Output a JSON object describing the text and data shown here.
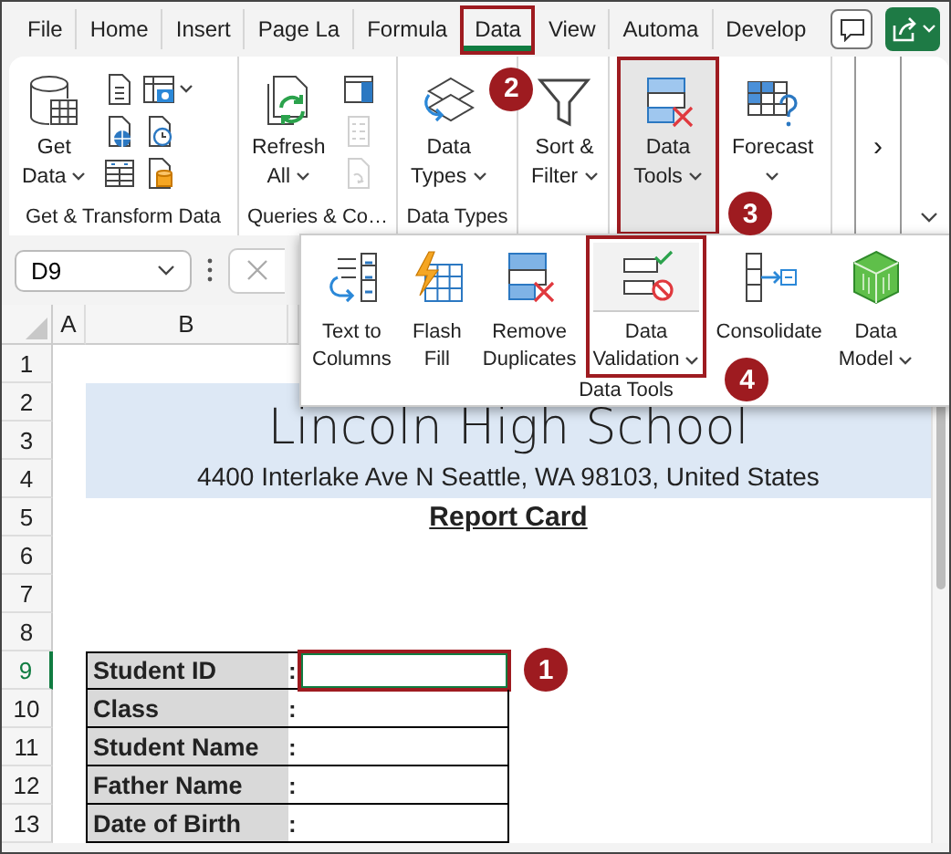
{
  "tabs": [
    {
      "label": "File",
      "selected": false
    },
    {
      "label": "Home",
      "selected": false
    },
    {
      "label": "Insert",
      "selected": false
    },
    {
      "label": "Page La",
      "selected": false
    },
    {
      "label": "Formula",
      "selected": false
    },
    {
      "label": "Data",
      "selected": true,
      "callout": "2"
    },
    {
      "label": "View",
      "selected": false
    },
    {
      "label": "Automa",
      "selected": false
    },
    {
      "label": "Develop",
      "selected": false
    }
  ],
  "ribbon": {
    "groups": [
      {
        "label": "Get & Transform Data",
        "buttons": [
          {
            "kind": "get-data",
            "lines": [
              "Get",
              "Data"
            ],
            "dropdown": true,
            "pressed": false
          }
        ],
        "small_buttons": [
          {
            "kind": "text-file",
            "dropdown": false,
            "disabled": false
          },
          {
            "kind": "picture-table",
            "dropdown": true,
            "disabled": false
          },
          {
            "kind": "web-file",
            "dropdown": false,
            "disabled": false
          },
          {
            "kind": "recent-file",
            "dropdown": false,
            "disabled": false
          },
          {
            "kind": "table",
            "dropdown": false,
            "disabled": false
          },
          {
            "kind": "database-file",
            "dropdown": false,
            "disabled": false
          }
        ]
      },
      {
        "label": "Queries & Co…",
        "buttons": [
          {
            "kind": "refresh",
            "lines": [
              "Refresh",
              "All"
            ],
            "dropdown": true,
            "pressed": false
          }
        ],
        "small_buttons": [
          {
            "kind": "pane",
            "dropdown": false,
            "disabled": false
          },
          {
            "kind": "properties",
            "dropdown": false,
            "disabled": true
          },
          {
            "kind": "links",
            "dropdown": false,
            "disabled": true
          }
        ]
      },
      {
        "label": "Data Types",
        "buttons": [
          {
            "kind": "data-types",
            "lines": [
              "Data",
              "Types"
            ],
            "dropdown": true,
            "pressed": false
          }
        ]
      },
      {
        "buttons": [
          {
            "kind": "sort-filter",
            "lines": [
              "Sort &",
              "Filter"
            ],
            "dropdown": true,
            "pressed": false
          }
        ]
      },
      {
        "buttons": [
          {
            "kind": "data-tools",
            "lines": [
              "Data",
              "Tools"
            ],
            "dropdown": true,
            "pressed": true,
            "callout": "3"
          }
        ]
      },
      {
        "buttons": [
          {
            "kind": "forecast",
            "lines": [
              "Forecast"
            ],
            "dropdown": true,
            "pressed": false
          }
        ]
      }
    ],
    "scroll_button": "›"
  },
  "formula_bar": {
    "name_box": "D9"
  },
  "flyout": {
    "group_label": "Data Tools",
    "buttons": [
      {
        "kind": "text-to-columns",
        "lines": [
          "Text to",
          "Columns"
        ],
        "dropdown": false
      },
      {
        "kind": "flash-fill",
        "lines": [
          "Flash",
          "Fill"
        ],
        "dropdown": false
      },
      {
        "kind": "remove-duplicates",
        "lines": [
          "Remove",
          "Duplicates"
        ],
        "dropdown": false
      },
      {
        "kind": "data-validation",
        "lines": [
          "Data",
          "Validation"
        ],
        "dropdown": true,
        "callout": "4"
      },
      {
        "kind": "consolidate",
        "lines": [
          "Consolidate"
        ],
        "dropdown": false
      },
      {
        "kind": "data-model",
        "lines": [
          "Data",
          "Model"
        ],
        "dropdown": true
      }
    ]
  },
  "sheet": {
    "columns": [
      "A",
      "B"
    ],
    "rows": [
      {
        "label": "1",
        "selected": false
      },
      {
        "label": "2",
        "selected": false
      },
      {
        "label": "3",
        "selected": false
      },
      {
        "label": "4",
        "selected": false
      },
      {
        "label": "5",
        "selected": false
      },
      {
        "label": "6",
        "selected": false
      },
      {
        "label": "7",
        "selected": false
      },
      {
        "label": "8",
        "selected": false
      },
      {
        "label": "9",
        "selected": true
      },
      {
        "label": "10",
        "selected": false
      },
      {
        "label": "11",
        "selected": false
      },
      {
        "label": "12",
        "selected": false
      },
      {
        "label": "13",
        "selected": false
      }
    ],
    "school": {
      "title": "Lincoln High School",
      "address": "4400 Interlake Ave N Seattle, WA 98103, United States"
    },
    "heading": "Report Card",
    "form": [
      {
        "label": "Student ID",
        "separator": ":",
        "selected": true,
        "callout": "1"
      },
      {
        "label": "Class",
        "separator": ":",
        "selected": false
      },
      {
        "label": "Student Name",
        "separator": ":",
        "selected": false
      },
      {
        "label": "Father Name",
        "separator": ":",
        "selected": false
      },
      {
        "label": "Date of Birth",
        "separator": ":",
        "selected": false
      }
    ]
  }
}
